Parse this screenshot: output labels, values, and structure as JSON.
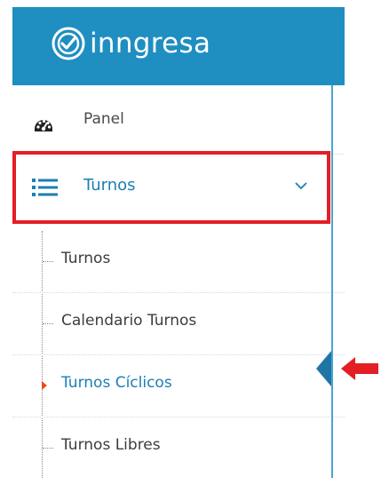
{
  "brand": {
    "logo_text": "inngresa",
    "header_color": "#1f8ec1"
  },
  "menu": {
    "panel": {
      "label": "Panel",
      "icon": "dashboard-gauge-icon"
    },
    "turnos": {
      "label": "Turnos",
      "icon": "list-icon",
      "expanded": true,
      "chevron": "chevron-down-icon"
    }
  },
  "submenu": {
    "items": [
      {
        "label": "Turnos",
        "active": false
      },
      {
        "label": "Calendario Turnos",
        "active": false
      },
      {
        "label": "Turnos Cíclicos",
        "active": true
      },
      {
        "label": "Turnos Libres",
        "active": false
      }
    ]
  },
  "annotations": {
    "highlight_box_color": "#e31e24",
    "pointer_arrow_color": "#e31e24"
  },
  "colors": {
    "active_text": "#1b7fb3",
    "default_text": "#3d3d3d",
    "active_bullet": "#e84c1d"
  }
}
